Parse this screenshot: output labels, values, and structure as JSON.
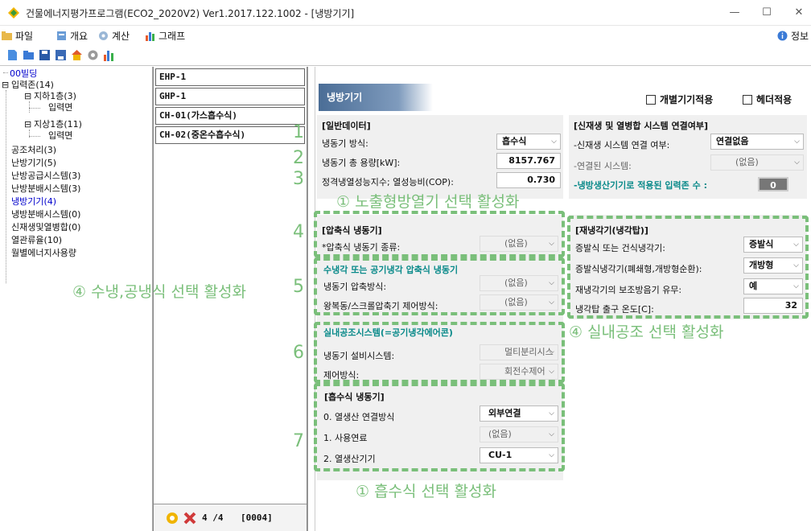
{
  "window": {
    "title": "건물에너지평가프로그램(ECO2_2020V2) Ver1.2017.122.1002 - [냉방기기]",
    "min": "—",
    "max": "☐",
    "close": "✕"
  },
  "menu": [
    "파일",
    "개요",
    "계산",
    "그래프"
  ],
  "menu_right": "정보",
  "tree": {
    "root": "00빌딩",
    "input_zone": "입력존(14)",
    "b1": "지하1층(3)",
    "b1_face": "입력면",
    "f1": "지상1층(11)",
    "f1_face": "입력면",
    "items": [
      "공조처리(3)",
      "난방기기(5)",
      "난방공급시스템(3)",
      "난방분배시스템(3)",
      "냉방기기(4)",
      "냉방분배시스템(0)",
      "신재생및열병합(0)",
      "열관류율(10)",
      "월별에너지사용량"
    ]
  },
  "list": {
    "items": [
      "EHP-1",
      "GHP-1",
      "CH-01(가스흡수식)",
      "CH-02(중온수흡수식)"
    ],
    "counter": "4 /4",
    "code": "[0004]"
  },
  "main": {
    "header": "냉방기기",
    "check_individual": "개별기기적용",
    "check_header": "헤더적용",
    "general": {
      "title": "[일반데이터]",
      "method_label": "냉동기 방식:",
      "method_value": "흡수식",
      "capacity_label": "냉동기 총 용량[kW]:",
      "capacity_value": "8157.767",
      "cop_label": "정격냉열성능지수; 열성능비(COP):",
      "cop_value": "0.730"
    },
    "renewable": {
      "title": "[신재생 및 열병합 시스템 연결여부]",
      "connect_label": "-신재생 시스템 연결 여부:",
      "connect_value": "연결없음",
      "system_label": "-연결된 시스템:",
      "system_value": "(없음)",
      "zones_label": "-냉방생산기기로 적용된 입력존 수 :",
      "zones_value": "0"
    },
    "compress": {
      "title": "[압축식 냉동기]",
      "type_label": "*압축식 냉동기 종류:",
      "type_value": "(없음)"
    },
    "water_air": {
      "title": "수냉각 또는 공기냉각 압축식 냉동기",
      "method_label": "냉동기 압축방식:",
      "method_value": "(없음)",
      "control_label": "왕복동/스크롤압축기 제어방식:",
      "control_value": "(없음)"
    },
    "indoor": {
      "title": "실내공조시스템(=공기냉각에어콘)",
      "facility_label": "냉동기 설비시스템:",
      "facility_value": "멀티분리시스",
      "control_label": "제어방식:",
      "control_value": "회전수제어"
    },
    "absorption": {
      "title": "[흡수식 냉동기]",
      "source_label": "0. 열생산 연결방식",
      "source_value": "외부연결",
      "fuel_label": "1. 사용연료",
      "fuel_value": "(없음)",
      "producer_label": "2. 열생산기기",
      "producer_value": "CU-1"
    },
    "cooling_tower": {
      "title": "[재냉각기(냉각탑)]",
      "type_label": "증발식 또는 건식냉각기:",
      "type_value": "증발식",
      "evap_label": "증발식냉각기(폐쇄형,개방형순환):",
      "evap_value": "개방형",
      "aux_label": "재냉각기의 보조방음기 유무:",
      "aux_value": "예",
      "temp_label": "냉각탑 출구 온도[C]:",
      "temp_value": "32"
    }
  },
  "annotations": {
    "n1": "1",
    "n2": "2",
    "n3": "3",
    "n4": "4",
    "n5": "5",
    "n6": "6",
    "n7": "7",
    "exposed": "① 노출형방열기 선택 활성화",
    "water_air": "④ 수냉,공냉식 선택 활성화",
    "indoor": "④ 실내공조 선택 활성화",
    "absorption": "① 흡수식 선택 활성화"
  },
  "colors": {
    "accent": "#7abf7a",
    "header": "#4a6d96",
    "teal": "#0a8a8a",
    "tree_link": "#0000cc"
  }
}
